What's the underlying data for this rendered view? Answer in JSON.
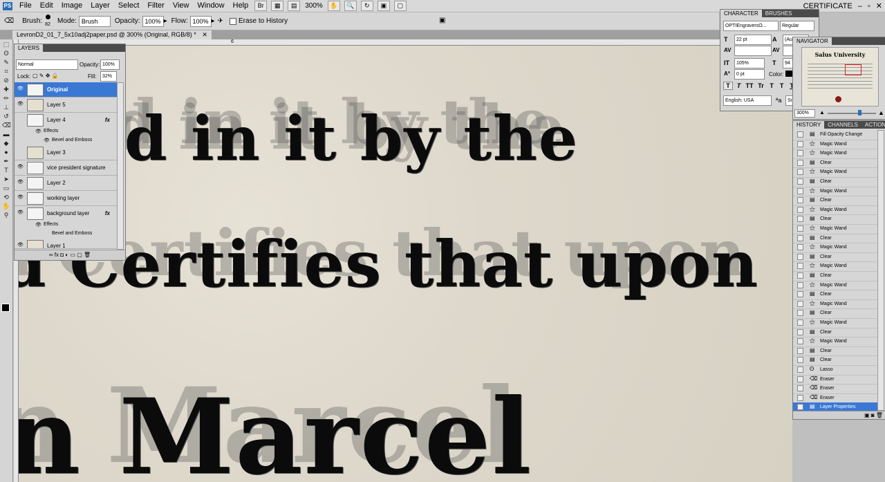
{
  "menubar": {
    "app_icon": "PS",
    "items": [
      "File",
      "Edit",
      "Image",
      "Layer",
      "Select",
      "Filter",
      "View",
      "Window",
      "Help"
    ],
    "zoom": "300%",
    "workspace": "CERTIFICATE"
  },
  "options": {
    "brush_label": "Brush:",
    "brush_size": "82",
    "mode_label": "Mode:",
    "mode_value": "Brush",
    "opacity_label": "Opacity:",
    "opacity_value": "100%",
    "flow_label": "Flow:",
    "flow_value": "100%",
    "erase_history_label": "Erase to History"
  },
  "document": {
    "tab_title": "LevronD2_01_7_5x10adj2paper.psd @ 300% (Original, RGB/8) *",
    "ruler_mark": "6"
  },
  "canvas_text": {
    "line1": "ed  in it by the",
    "line2": "d Certifies that upon",
    "line3": "n Marcel"
  },
  "layers_panel": {
    "tab": "LAYERS",
    "blend_mode": "Normal",
    "opacity_label": "Opacity:",
    "opacity_value": "100%",
    "lock_label": "Lock:",
    "fill_label": "Fill:",
    "fill_value": "32%",
    "layers": [
      {
        "name": "Original",
        "selected": true
      },
      {
        "name": "Layer 5"
      },
      {
        "name": "Layer 4",
        "fx": "fx"
      },
      {
        "name": "Layer 3"
      },
      {
        "name": "vice president signature"
      },
      {
        "name": "Layer 2"
      },
      {
        "name": "working layer"
      },
      {
        "name": "background layer",
        "fx": "fx"
      },
      {
        "name": "Layer 1"
      }
    ],
    "effects_label": "Effects",
    "bevel_label": "Bevel and Emboss"
  },
  "character_panel": {
    "tabs": [
      "CHARACTER",
      "BRUSHES"
    ],
    "font_family": "OPTIEngraversO...",
    "font_style": "Regular",
    "font_size": "22 pt",
    "leading": "(Au",
    "tracking_vert_scale": "105%",
    "horiz_scale": "94",
    "baseline": "0 pt",
    "color_label": "Color:",
    "language": "English: USA",
    "aa_label": "a",
    "aa_value": "Sm",
    "style_buttons": [
      "T",
      "T",
      "TT",
      "Tr",
      "T",
      "T",
      "T",
      "T"
    ]
  },
  "navigator_panel": {
    "tab": "NAVIGATOR",
    "zoom": "300%",
    "preview_title": "Salus University"
  },
  "history_panel": {
    "tabs": [
      "HISTORY",
      "CHANNELS",
      "ACTIONS"
    ],
    "items": [
      {
        "label": "Fill Opacity Change",
        "icon": "doc-icon"
      },
      {
        "label": "Magic Wand",
        "icon": "wand-icon"
      },
      {
        "label": "Magic Wand",
        "icon": "wand-icon"
      },
      {
        "label": "Clear",
        "icon": "doc-icon"
      },
      {
        "label": "Magic Wand",
        "icon": "wand-icon"
      },
      {
        "label": "Clear",
        "icon": "doc-icon"
      },
      {
        "label": "Magic Wand",
        "icon": "wand-icon"
      },
      {
        "label": "Clear",
        "icon": "doc-icon"
      },
      {
        "label": "Magic Wand",
        "icon": "wand-icon"
      },
      {
        "label": "Clear",
        "icon": "doc-icon"
      },
      {
        "label": "Magic Wand",
        "icon": "wand-icon"
      },
      {
        "label": "Clear",
        "icon": "doc-icon"
      },
      {
        "label": "Magic Wand",
        "icon": "wand-icon"
      },
      {
        "label": "Clear",
        "icon": "doc-icon"
      },
      {
        "label": "Magic Wand",
        "icon": "wand-icon"
      },
      {
        "label": "Clear",
        "icon": "doc-icon"
      },
      {
        "label": "Magic Wand",
        "icon": "wand-icon"
      },
      {
        "label": "Clear",
        "icon": "doc-icon"
      },
      {
        "label": "Magic Wand",
        "icon": "wand-icon"
      },
      {
        "label": "Clear",
        "icon": "doc-icon"
      },
      {
        "label": "Magic Wand",
        "icon": "wand-icon"
      },
      {
        "label": "Clear",
        "icon": "doc-icon"
      },
      {
        "label": "Magic Wand",
        "icon": "wand-icon"
      },
      {
        "label": "Clear",
        "icon": "doc-icon"
      },
      {
        "label": "Clear",
        "icon": "doc-icon"
      },
      {
        "label": "Lasso",
        "icon": "lasso-icon"
      },
      {
        "label": "Eraser",
        "icon": "eraser-icon"
      },
      {
        "label": "Eraser",
        "icon": "eraser-icon"
      },
      {
        "label": "Eraser",
        "icon": "eraser-icon"
      },
      {
        "label": "Layer Properties",
        "icon": "doc-icon",
        "selected": true
      }
    ]
  },
  "colors": {
    "selection": "#3a78d4",
    "panel_bg": "#d6d6d6",
    "paper": "#ddd8cb"
  }
}
